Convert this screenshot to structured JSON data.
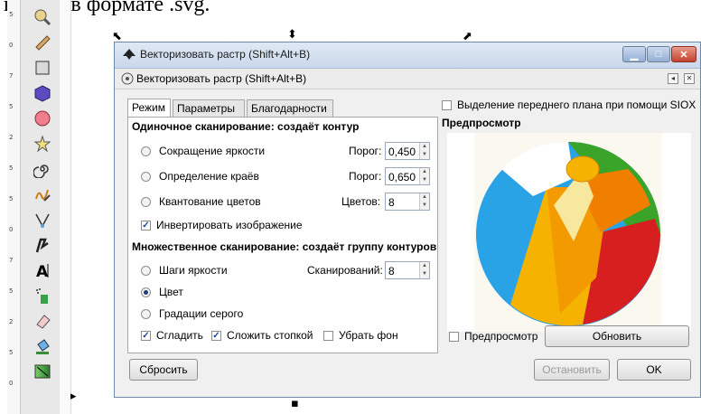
{
  "document": {
    "caption_fragment": "в файл в формате .svg."
  },
  "toolbox": {
    "ruler_ticks": [
      "5",
      "0",
      "7",
      "5",
      "2",
      "5",
      "5",
      "0",
      "7",
      "5",
      "2",
      "5",
      "0"
    ],
    "tools": [
      "zoom-tool",
      "measure-tool",
      "rect-tool",
      "3d-box-tool",
      "ellipse-tool",
      "star-tool",
      "spiral-tool",
      "pencil-tool",
      "pen-tool",
      "calligraphy-tool",
      "text-tool",
      "spray-tool",
      "eraser-tool",
      "paint-bucket-tool",
      "gradient-tool"
    ]
  },
  "dialog": {
    "window_title": "Векторизовать растр (Shift+Alt+B)",
    "subtitle": "Векторизовать растр (Shift+Alt+B)",
    "tabs": [
      {
        "label": "Режим",
        "active": true
      },
      {
        "label": "Параметры",
        "active": false
      },
      {
        "label": "Благодарности",
        "active": false
      }
    ],
    "single_scan": {
      "title": "Одиночное сканирование: создаёт контур",
      "options": [
        {
          "label": "Сокращение яркости",
          "param_label": "Порог:",
          "value": "0,450",
          "selected": false
        },
        {
          "label": "Определение краёв",
          "param_label": "Порог:",
          "value": "0,650",
          "selected": false
        },
        {
          "label": "Квантование цветов",
          "param_label": "Цветов:",
          "value": "8",
          "selected": false
        }
      ],
      "invert_label": "Инвертировать изображение",
      "invert_checked": true
    },
    "multi_scan": {
      "title": "Множественное сканирование: создаёт группу контуров",
      "options": [
        {
          "label": "Шаги яркости",
          "selected": false
        },
        {
          "label": "Цвет",
          "selected": true
        },
        {
          "label": "Градации серого",
          "selected": false
        }
      ],
      "scans_label": "Сканирований:",
      "scans_value": "8",
      "smooth_label": "Сгладить",
      "smooth_checked": true,
      "stack_label": "Сложить стопкой",
      "stack_checked": true,
      "remove_bg_label": "Убрать фон",
      "remove_bg_checked": false
    },
    "siox_label": "Выделение переднего плана при помощи SIOX",
    "siox_checked": false,
    "preview_title": "Предпросмотр",
    "preview_check_label": "Предпросмотр",
    "preview_checked": false,
    "update_button": "Обновить",
    "reset_button": "Сбросить",
    "stop_button": "Остановить",
    "ok_button": "OK"
  },
  "colors": {
    "ball_blue": "#29a3e6",
    "ball_yellow": "#f5b300",
    "ball_orange": "#f07f00",
    "ball_red": "#d81f1f",
    "ball_green": "#39a32a",
    "ball_white": "#ffffff",
    "ball_pale": "#f7e8a0"
  }
}
